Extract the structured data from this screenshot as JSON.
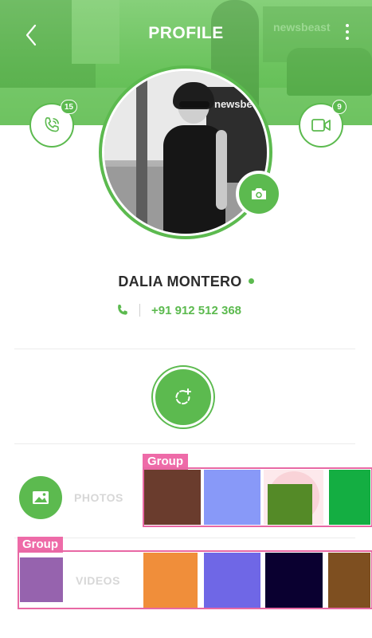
{
  "header": {
    "title": "PROFILE",
    "back_icon": "chevron-left-icon",
    "menu_icon": "more-vertical-icon",
    "background_text": "newsbeast"
  },
  "call_button": {
    "icon": "phone-call-icon",
    "badge": "15"
  },
  "video_button": {
    "icon": "video-camera-icon",
    "badge": "9"
  },
  "avatar": {
    "bus_sign": "newsbe",
    "camera_icon": "camera-icon"
  },
  "profile": {
    "name": "DALIA MONTERO",
    "status_color": "#5cba4f",
    "phone_icon": "phone-icon",
    "phone": "+91 912 512 368"
  },
  "add_button": {
    "icon": "add-contact-icon"
  },
  "photos": {
    "label": "PHOTOS",
    "icon": "image-icon",
    "group_label": "Group",
    "thumbs": [
      "#6a3c2d",
      "#8899f8",
      "#548a27",
      "#14ae42"
    ]
  },
  "videos": {
    "label": "VIDEOS",
    "group_label": "Group",
    "thumbs": [
      "#9663ae",
      "#f08e3a",
      "#6f67e6",
      "#0a0030",
      "#7e4f20"
    ]
  },
  "colors": {
    "accent": "#5cba4f",
    "group_outline": "#e868a4"
  }
}
